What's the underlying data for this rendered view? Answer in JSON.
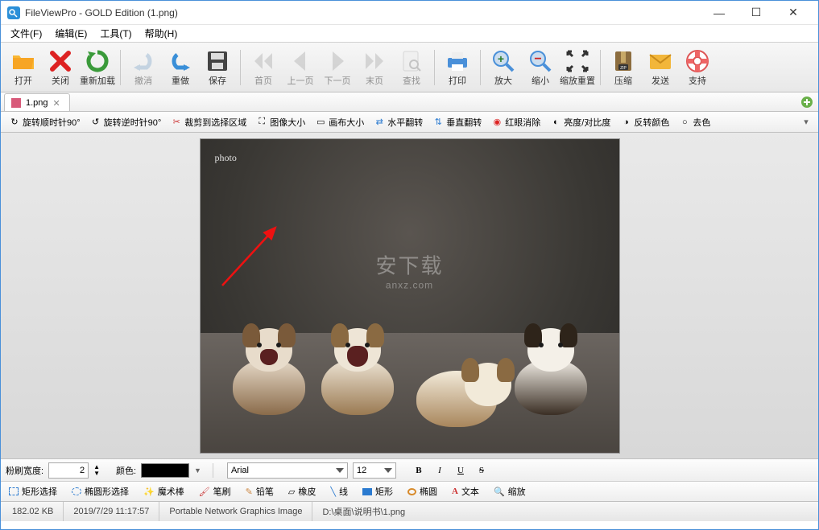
{
  "window": {
    "title": "FileViewPro - GOLD Edition (1.png)"
  },
  "menu": {
    "file": "文件(F)",
    "edit": "编辑(E)",
    "tools": "工具(T)",
    "help": "帮助(H)"
  },
  "toolbar": {
    "open": "打开",
    "close": "关闭",
    "reload": "重新加载",
    "undo": "撤消",
    "redo": "重做",
    "save": "保存",
    "first": "首页",
    "prev": "上一页",
    "next": "下一页",
    "last": "末页",
    "find": "查找",
    "print": "打印",
    "zoomin": "放大",
    "zoomout": "缩小",
    "zoomreset": "缩放重置",
    "compress": "压缩",
    "send": "发送",
    "support": "支持"
  },
  "tab": {
    "label": "1.png"
  },
  "imgtoolbar": {
    "rotcw": "旋转顺时针90°",
    "rotccw": "旋转逆时针90°",
    "crop": "裁剪到选择区域",
    "imgsize": "图像大小",
    "canvassize": "画布大小",
    "fliph": "水平翻转",
    "flipv": "垂直翻转",
    "redeye": "红眼消除",
    "brightness": "亮度/对比度",
    "invert": "反转颜色",
    "desat": "去色"
  },
  "bottom1": {
    "brushwidth_label": "粉刷宽度:",
    "brushwidth_value": "2",
    "color_label": "颜色:",
    "font_value": "Arial",
    "fontsize_value": "12"
  },
  "bottom2": {
    "rectsel": "矩形选择",
    "ellipsesel": "椭圆形选择",
    "wand": "魔术棒",
    "brush": "笔刷",
    "pencil": "铅笔",
    "eraser": "橡皮",
    "line": "线",
    "rect": "矩形",
    "ellipse": "椭圆",
    "text": "文本",
    "zoom": "缩放"
  },
  "status": {
    "size": "182.02 KB",
    "datetime": "2019/7/29 11:17:57",
    "format": "Portable Network Graphics Image",
    "path": "D:\\桌面\\说明书\\1.png"
  },
  "watermark": {
    "main": "安下载",
    "sub": "anxz.com",
    "sig": "photo"
  }
}
